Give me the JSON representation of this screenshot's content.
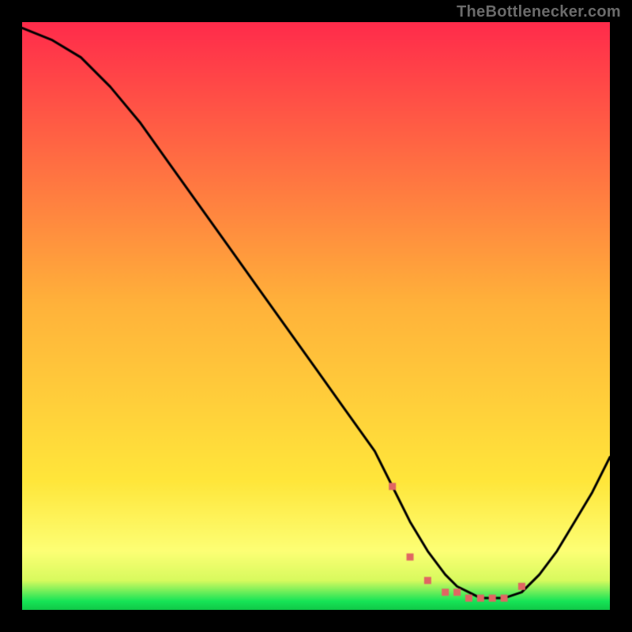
{
  "attribution": "TheBottlenecker.com",
  "colors": {
    "page_bg": "#000000",
    "line": "#000000",
    "marker": "#e06663",
    "gradient_top": "#ff2b4b",
    "gradient_mid": "#ffd23a",
    "gradient_yellowband": "#fdff75",
    "gradient_bottom": "#17e557"
  },
  "chart_data": {
    "type": "line",
    "title": "",
    "xlabel": "",
    "ylabel": "",
    "xlim": [
      0,
      100
    ],
    "ylim": [
      0,
      100
    ],
    "series": [
      {
        "name": "curve",
        "x": [
          0,
          5,
          10,
          15,
          20,
          25,
          30,
          35,
          40,
          45,
          50,
          55,
          60,
          63,
          66,
          69,
          72,
          74,
          76,
          78,
          80,
          82,
          85,
          88,
          91,
          94,
          97,
          100
        ],
        "y": [
          99,
          97,
          94,
          89,
          83,
          76,
          69,
          62,
          55,
          48,
          41,
          34,
          27,
          21,
          15,
          10,
          6,
          4,
          3,
          2,
          2,
          2,
          3,
          6,
          10,
          15,
          20,
          26
        ]
      }
    ],
    "markers": {
      "x": [
        63,
        66,
        69,
        72,
        74,
        76,
        78,
        80,
        82,
        85
      ],
      "y": [
        21,
        9,
        5,
        3,
        3,
        2,
        2,
        2,
        2,
        4
      ]
    },
    "background_gradient": {
      "stops": [
        {
          "pos": 0.0,
          "color": "#ff2b4b"
        },
        {
          "pos": 0.48,
          "color": "#ffb23a"
        },
        {
          "pos": 0.78,
          "color": "#ffe63a"
        },
        {
          "pos": 0.9,
          "color": "#fdff75"
        },
        {
          "pos": 0.95,
          "color": "#d8fa5e"
        },
        {
          "pos": 0.985,
          "color": "#17e557"
        },
        {
          "pos": 1.0,
          "color": "#10c847"
        }
      ]
    }
  }
}
